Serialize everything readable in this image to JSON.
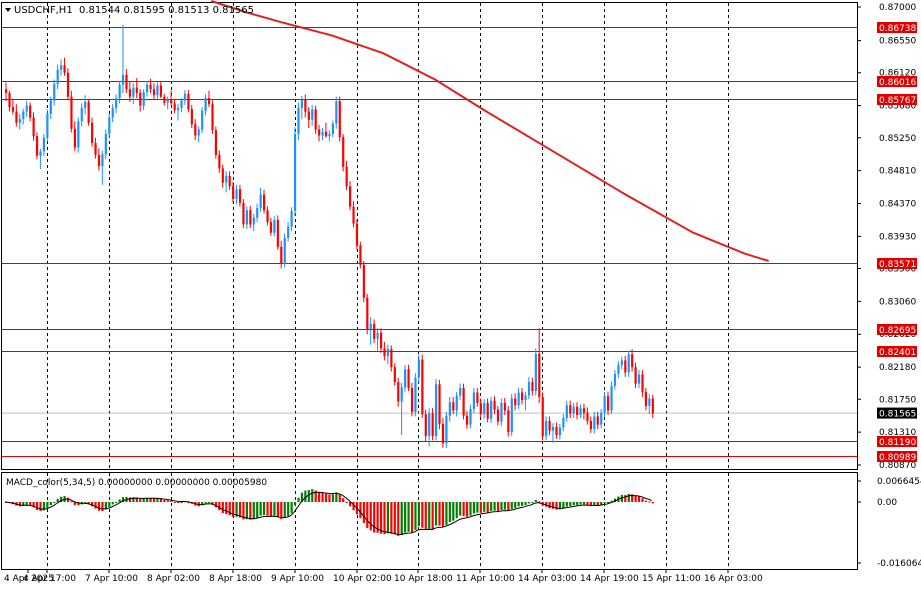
{
  "chart_data": {
    "type": "candlestick",
    "title": {
      "symbol": "USDCHF,H1",
      "ohlc": "0.81544 0.81595 0.81513 0.81565"
    },
    "price_axis": {
      "ylim": [
        0.8087,
        0.87
      ],
      "ticks": [
        "0.87000",
        "0.86550",
        "0.86120",
        "0.85680",
        "0.85250",
        "0.84810",
        "0.84370",
        "0.83930",
        "0.83500",
        "0.83060",
        "0.82620",
        "0.82180",
        "0.81750",
        "0.81310",
        "0.80870"
      ],
      "current_price": "0.81565"
    },
    "time_axis": {
      "labels": [
        "4 Apr 2025",
        "4 Apr 17:00",
        "7 Apr 10:00",
        "8 Apr 02:00",
        "8 Apr 18:00",
        "9 Apr 10:00",
        "10 Apr 02:00",
        "10 Apr 18:00",
        "11 Apr 10:00",
        "14 Apr 03:00",
        "14 Apr 19:00",
        "15 Apr 11:00",
        "16 Apr 03:00"
      ]
    },
    "levels": [
      "0.86738",
      "0.86016",
      "0.85767",
      "0.83571",
      "0.82695",
      "0.82401",
      "0.81190",
      "0.80989"
    ],
    "moving_average": [
      {
        "bar": 60,
        "value": 0.8708
      },
      {
        "bar": 70,
        "value": 0.8693
      },
      {
        "bar": 80,
        "value": 0.868
      },
      {
        "bar": 95,
        "value": 0.8662
      },
      {
        "bar": 110,
        "value": 0.8638
      },
      {
        "bar": 125,
        "value": 0.8603
      },
      {
        "bar": 140,
        "value": 0.856
      },
      {
        "bar": 160,
        "value": 0.8505
      },
      {
        "bar": 180,
        "value": 0.845
      },
      {
        "bar": 200,
        "value": 0.8398
      },
      {
        "bar": 215,
        "value": 0.837
      },
      {
        "bar": 222,
        "value": 0.836
      }
    ],
    "candles": [
      [
        0.859,
        0.8599,
        0.8574,
        0.8585
      ],
      [
        0.8585,
        0.8588,
        0.856,
        0.8566
      ],
      [
        0.8566,
        0.8577,
        0.8556,
        0.856
      ],
      [
        0.856,
        0.857,
        0.854,
        0.8545
      ],
      [
        0.8545,
        0.8557,
        0.8536,
        0.855
      ],
      [
        0.855,
        0.8564,
        0.8543,
        0.856
      ],
      [
        0.856,
        0.8574,
        0.8553,
        0.8568
      ],
      [
        0.8568,
        0.8572,
        0.8547,
        0.8552
      ],
      [
        0.8552,
        0.8559,
        0.8521,
        0.8527
      ],
      [
        0.8527,
        0.8532,
        0.8496,
        0.8501
      ],
      [
        0.8501,
        0.851,
        0.8483,
        0.8507
      ],
      [
        0.8507,
        0.853,
        0.85,
        0.8525
      ],
      [
        0.8525,
        0.8563,
        0.852,
        0.8557
      ],
      [
        0.8557,
        0.858,
        0.855,
        0.8575
      ],
      [
        0.8575,
        0.8603,
        0.8568,
        0.8597
      ],
      [
        0.8597,
        0.8623,
        0.859,
        0.8616
      ],
      [
        0.8616,
        0.863,
        0.8608,
        0.8622
      ],
      [
        0.8622,
        0.8632,
        0.8608,
        0.8612
      ],
      [
        0.8612,
        0.8618,
        0.8575,
        0.858
      ],
      [
        0.858,
        0.8588,
        0.8532,
        0.8537
      ],
      [
        0.8537,
        0.8547,
        0.8507,
        0.8512
      ],
      [
        0.8512,
        0.8552,
        0.8505,
        0.8547
      ],
      [
        0.8547,
        0.8571,
        0.854,
        0.8565
      ],
      [
        0.8565,
        0.8582,
        0.8556,
        0.8573
      ],
      [
        0.8573,
        0.8576,
        0.8541,
        0.8545
      ],
      [
        0.8545,
        0.8552,
        0.8513,
        0.8518
      ],
      [
        0.8518,
        0.8525,
        0.8497,
        0.8502
      ],
      [
        0.8502,
        0.8511,
        0.8481,
        0.8487
      ],
      [
        0.8487,
        0.8508,
        0.8462,
        0.8503
      ],
      [
        0.8503,
        0.8536,
        0.8496,
        0.853
      ],
      [
        0.853,
        0.8557,
        0.8525,
        0.8552
      ],
      [
        0.8552,
        0.857,
        0.8546,
        0.8565
      ],
      [
        0.8565,
        0.8583,
        0.8558,
        0.8578
      ],
      [
        0.8578,
        0.8601,
        0.8571,
        0.8596
      ],
      [
        0.8596,
        0.8676,
        0.8585,
        0.8609
      ],
      [
        0.8609,
        0.8617,
        0.8585,
        0.859
      ],
      [
        0.859,
        0.86,
        0.8573,
        0.858
      ],
      [
        0.858,
        0.8598,
        0.857,
        0.8592
      ],
      [
        0.8592,
        0.8605,
        0.8578,
        0.8585
      ],
      [
        0.8585,
        0.859,
        0.856,
        0.8568
      ],
      [
        0.8568,
        0.859,
        0.8562,
        0.8586
      ],
      [
        0.8586,
        0.8601,
        0.858,
        0.8596
      ],
      [
        0.8596,
        0.8604,
        0.8585,
        0.859
      ],
      [
        0.859,
        0.8598,
        0.8577,
        0.8582
      ],
      [
        0.8582,
        0.86,
        0.8576,
        0.8595
      ],
      [
        0.8595,
        0.86,
        0.8578,
        0.858
      ],
      [
        0.858,
        0.8584,
        0.8568,
        0.8572
      ],
      [
        0.8572,
        0.858,
        0.8563,
        0.8576
      ],
      [
        0.8576,
        0.8588,
        0.8569,
        0.8571
      ],
      [
        0.8571,
        0.8577,
        0.8558,
        0.8562
      ],
      [
        0.8562,
        0.857,
        0.8548,
        0.8565
      ],
      [
        0.8565,
        0.8578,
        0.8559,
        0.8575
      ],
      [
        0.8575,
        0.8589,
        0.8569,
        0.8584
      ],
      [
        0.8584,
        0.8589,
        0.8559,
        0.8563
      ],
      [
        0.8563,
        0.8569,
        0.8538,
        0.8543
      ],
      [
        0.8543,
        0.855,
        0.8522,
        0.8528
      ],
      [
        0.8528,
        0.854,
        0.8519,
        0.8536
      ],
      [
        0.8536,
        0.8566,
        0.8531,
        0.8561
      ],
      [
        0.8561,
        0.8583,
        0.8555,
        0.8578
      ],
      [
        0.8578,
        0.8588,
        0.8566,
        0.857
      ],
      [
        0.857,
        0.8575,
        0.853,
        0.8535
      ],
      [
        0.8535,
        0.854,
        0.8497,
        0.8502
      ],
      [
        0.8502,
        0.8508,
        0.8478,
        0.8484
      ],
      [
        0.8484,
        0.8489,
        0.8458,
        0.8465
      ],
      [
        0.8465,
        0.848,
        0.8452,
        0.8474
      ],
      [
        0.8474,
        0.848,
        0.8455,
        0.846
      ],
      [
        0.846,
        0.8466,
        0.8438,
        0.8443
      ],
      [
        0.8443,
        0.8462,
        0.8436,
        0.8456
      ],
      [
        0.8456,
        0.8462,
        0.8433,
        0.8438
      ],
      [
        0.8438,
        0.8443,
        0.8404,
        0.8409
      ],
      [
        0.8409,
        0.8433,
        0.8403,
        0.8428
      ],
      [
        0.8428,
        0.8434,
        0.8404,
        0.8409
      ],
      [
        0.8409,
        0.8423,
        0.84,
        0.8418
      ],
      [
        0.8418,
        0.8437,
        0.8412,
        0.8431
      ],
      [
        0.8431,
        0.8458,
        0.8426,
        0.8449
      ],
      [
        0.8449,
        0.8455,
        0.8424,
        0.8428
      ],
      [
        0.8428,
        0.8433,
        0.8408,
        0.8412
      ],
      [
        0.8412,
        0.8418,
        0.8394,
        0.8398
      ],
      [
        0.8398,
        0.842,
        0.8393,
        0.8415
      ],
      [
        0.8415,
        0.8421,
        0.8375,
        0.8379
      ],
      [
        0.8379,
        0.8387,
        0.835,
        0.8356
      ],
      [
        0.8356,
        0.8397,
        0.8351,
        0.8391
      ],
      [
        0.8391,
        0.8412,
        0.8386,
        0.8406
      ],
      [
        0.8406,
        0.8432,
        0.84,
        0.8427
      ],
      [
        0.8427,
        0.8539,
        0.842,
        0.853
      ],
      [
        0.853,
        0.8572,
        0.8522,
        0.8565
      ],
      [
        0.8565,
        0.8581,
        0.855,
        0.8576
      ],
      [
        0.8576,
        0.8583,
        0.8552,
        0.856
      ],
      [
        0.856,
        0.8566,
        0.8538,
        0.8549
      ],
      [
        0.8549,
        0.8569,
        0.8541,
        0.8563
      ],
      [
        0.8563,
        0.8568,
        0.853,
        0.8536
      ],
      [
        0.8536,
        0.8542,
        0.852,
        0.8528
      ],
      [
        0.8528,
        0.8538,
        0.8522,
        0.8533
      ],
      [
        0.8533,
        0.8545,
        0.8525,
        0.8527
      ],
      [
        0.8527,
        0.8535,
        0.852,
        0.853
      ],
      [
        0.853,
        0.8548,
        0.8526,
        0.8544
      ],
      [
        0.8544,
        0.858,
        0.8537,
        0.8574
      ],
      [
        0.8574,
        0.858,
        0.852,
        0.8526
      ],
      [
        0.8526,
        0.853,
        0.848,
        0.8486
      ],
      [
        0.8486,
        0.8494,
        0.8455,
        0.846
      ],
      [
        0.846,
        0.8467,
        0.8428,
        0.8433
      ],
      [
        0.8433,
        0.844,
        0.8405,
        0.841
      ],
      [
        0.841,
        0.8415,
        0.8375,
        0.8381
      ],
      [
        0.8381,
        0.8386,
        0.835,
        0.8355
      ],
      [
        0.8355,
        0.836,
        0.8305,
        0.8311
      ],
      [
        0.8311,
        0.8316,
        0.8262,
        0.8269
      ],
      [
        0.8269,
        0.8285,
        0.8248,
        0.8276
      ],
      [
        0.8276,
        0.8282,
        0.825,
        0.8256
      ],
      [
        0.8256,
        0.827,
        0.824,
        0.8264
      ],
      [
        0.8264,
        0.827,
        0.8237,
        0.8243
      ],
      [
        0.8243,
        0.8252,
        0.8227,
        0.8233
      ],
      [
        0.8233,
        0.8248,
        0.8222,
        0.8242
      ],
      [
        0.8242,
        0.8247,
        0.8212,
        0.8218
      ],
      [
        0.8218,
        0.8223,
        0.8193,
        0.8198
      ],
      [
        0.8198,
        0.8204,
        0.8165,
        0.8172
      ],
      [
        0.8172,
        0.8197,
        0.8127,
        0.8191
      ],
      [
        0.8191,
        0.8221,
        0.8185,
        0.8215
      ],
      [
        0.8215,
        0.8221,
        0.8186,
        0.819
      ],
      [
        0.819,
        0.8197,
        0.8152,
        0.8158
      ],
      [
        0.8158,
        0.821,
        0.8152,
        0.8204
      ],
      [
        0.8204,
        0.8235,
        0.8196,
        0.8228
      ],
      [
        0.8228,
        0.8235,
        0.815,
        0.8155
      ],
      [
        0.8155,
        0.8161,
        0.8119,
        0.8126
      ],
      [
        0.8126,
        0.8163,
        0.8112,
        0.8156
      ],
      [
        0.8156,
        0.8163,
        0.812,
        0.8126
      ],
      [
        0.8126,
        0.8202,
        0.812,
        0.8195
      ],
      [
        0.8195,
        0.8201,
        0.8135,
        0.8142
      ],
      [
        0.8142,
        0.815,
        0.811,
        0.8116
      ],
      [
        0.8116,
        0.8158,
        0.811,
        0.8153
      ],
      [
        0.8153,
        0.8178,
        0.8145,
        0.8171
      ],
      [
        0.8171,
        0.8178,
        0.8155,
        0.816
      ],
      [
        0.816,
        0.8185,
        0.8152,
        0.818
      ],
      [
        0.818,
        0.8196,
        0.8174,
        0.819
      ],
      [
        0.819,
        0.8196,
        0.8148,
        0.8153
      ],
      [
        0.8153,
        0.8159,
        0.8135,
        0.8141
      ],
      [
        0.8141,
        0.8168,
        0.8136,
        0.8162
      ],
      [
        0.8162,
        0.819,
        0.8156,
        0.8184
      ],
      [
        0.8184,
        0.819,
        0.8165,
        0.817
      ],
      [
        0.817,
        0.8176,
        0.815,
        0.8155
      ],
      [
        0.8155,
        0.8175,
        0.8149,
        0.817
      ],
      [
        0.817,
        0.8176,
        0.8144,
        0.8149
      ],
      [
        0.8149,
        0.8178,
        0.8143,
        0.8173
      ],
      [
        0.8173,
        0.8179,
        0.8155,
        0.8161
      ],
      [
        0.8161,
        0.8166,
        0.814,
        0.8145
      ],
      [
        0.8145,
        0.8176,
        0.8139,
        0.817
      ],
      [
        0.817,
        0.8177,
        0.8154,
        0.816
      ],
      [
        0.816,
        0.8166,
        0.8125,
        0.8131
      ],
      [
        0.8131,
        0.8182,
        0.8126,
        0.8176
      ],
      [
        0.8176,
        0.8183,
        0.816,
        0.8167
      ],
      [
        0.8167,
        0.819,
        0.8162,
        0.8184
      ],
      [
        0.8184,
        0.819,
        0.8168,
        0.8174
      ],
      [
        0.8174,
        0.8185,
        0.816,
        0.818
      ],
      [
        0.818,
        0.8205,
        0.8175,
        0.8198
      ],
      [
        0.8198,
        0.8204,
        0.818,
        0.8186
      ],
      [
        0.8186,
        0.8243,
        0.818,
        0.8236
      ],
      [
        0.8236,
        0.827,
        0.817,
        0.8178
      ],
      [
        0.8178,
        0.8184,
        0.812,
        0.8126
      ],
      [
        0.8126,
        0.8152,
        0.812,
        0.8146
      ],
      [
        0.8146,
        0.8152,
        0.8127,
        0.8133
      ],
      [
        0.8133,
        0.8143,
        0.8117,
        0.8138
      ],
      [
        0.8138,
        0.8144,
        0.8122,
        0.8127
      ],
      [
        0.8127,
        0.8142,
        0.8121,
        0.8137
      ],
      [
        0.8137,
        0.8155,
        0.8132,
        0.815
      ],
      [
        0.815,
        0.8173,
        0.8145,
        0.8167
      ],
      [
        0.8167,
        0.8173,
        0.815,
        0.8156
      ],
      [
        0.8156,
        0.817,
        0.815,
        0.8165
      ],
      [
        0.8165,
        0.8171,
        0.8148,
        0.8154
      ],
      [
        0.8154,
        0.8168,
        0.815,
        0.8163
      ],
      [
        0.8163,
        0.8169,
        0.8148,
        0.8157
      ],
      [
        0.8157,
        0.8164,
        0.8141,
        0.8146
      ],
      [
        0.8146,
        0.8152,
        0.813,
        0.8135
      ],
      [
        0.8135,
        0.8158,
        0.8129,
        0.8152
      ],
      [
        0.8152,
        0.8158,
        0.8135,
        0.8141
      ],
      [
        0.8141,
        0.8162,
        0.8136,
        0.8157
      ],
      [
        0.8157,
        0.8185,
        0.8151,
        0.8179
      ],
      [
        0.8179,
        0.8185,
        0.8154,
        0.816
      ],
      [
        0.816,
        0.8199,
        0.8155,
        0.8193
      ],
      [
        0.8193,
        0.8214,
        0.8188,
        0.8209
      ],
      [
        0.8209,
        0.8226,
        0.8203,
        0.8221
      ],
      [
        0.8221,
        0.8232,
        0.8215,
        0.8227
      ],
      [
        0.8227,
        0.8233,
        0.8205,
        0.8211
      ],
      [
        0.8211,
        0.824,
        0.8205,
        0.8235
      ],
      [
        0.8235,
        0.8242,
        0.8212,
        0.8218
      ],
      [
        0.8218,
        0.8224,
        0.819,
        0.8196
      ],
      [
        0.8196,
        0.8214,
        0.819,
        0.8208
      ],
      [
        0.8208,
        0.8214,
        0.8178,
        0.8185
      ],
      [
        0.8185,
        0.819,
        0.816,
        0.8166
      ],
      [
        0.8166,
        0.8182,
        0.8155,
        0.8176
      ],
      [
        0.8176,
        0.8181,
        0.815,
        0.8156
      ]
    ],
    "macd": {
      "title": "MACD_color(5,34,5) 0.00000000 0.00000000 0.00005980",
      "ylim": [
        -0.0016064,
        0.0066454
      ],
      "ticks": [
        "0.0066454",
        "0.00",
        "-0.0160640"
      ],
      "colors": {
        "up": "#008000",
        "down": "#ff0000",
        "signal": "#000000"
      }
    },
    "colors": {
      "bull": "#1e90ff",
      "bear": "#ff0000",
      "moving_average": "#e02020",
      "level_line": "#e00000",
      "level_label_bg": "#e00000",
      "current_price_line": "#c0c0c0"
    }
  }
}
